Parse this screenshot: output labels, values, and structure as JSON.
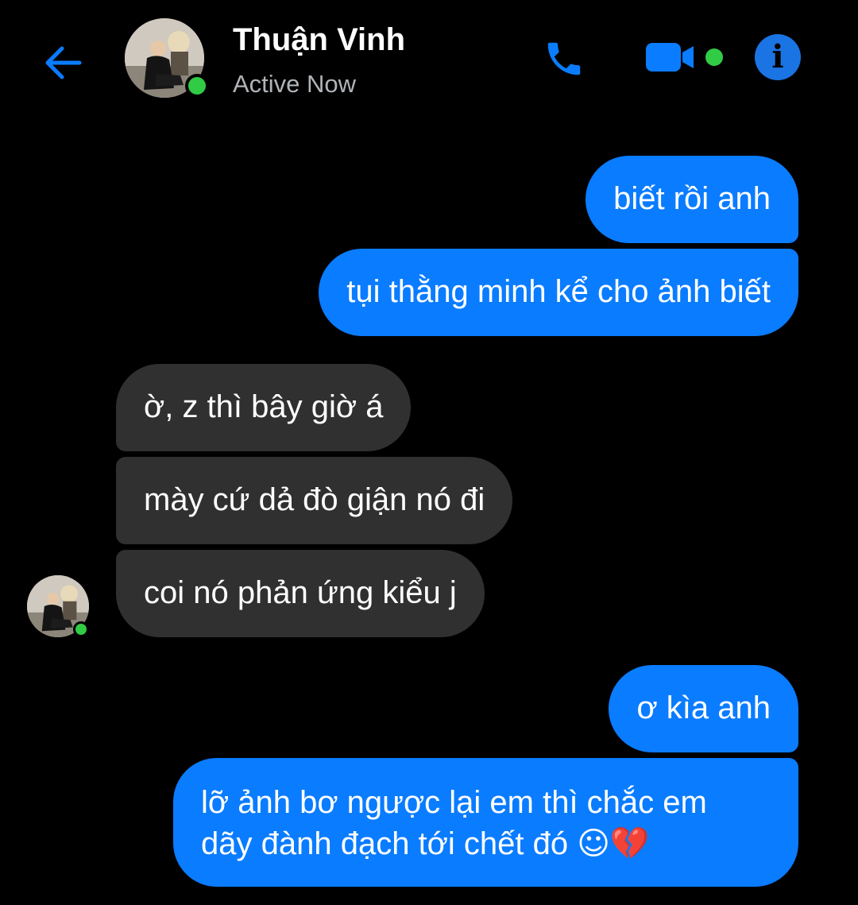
{
  "header": {
    "contact_name": "Thuận Vinh",
    "status": "Active Now",
    "back_icon": "arrow-left-icon",
    "call_icon": "phone-icon",
    "video_icon": "video-camera-icon",
    "info_icon": "info-icon"
  },
  "colors": {
    "accent": "#0a7cff",
    "received_bubble": "#303030",
    "presence": "#31cc46",
    "background": "#000000"
  },
  "messages": [
    {
      "from": "me",
      "text": "biết rồi anh"
    },
    {
      "from": "me",
      "text": "tụi thằng minh kể cho ảnh biết"
    },
    {
      "from": "contact",
      "text": "ờ, z thì bây giờ á"
    },
    {
      "from": "contact",
      "text": "mày cứ dả đò giận nó đi"
    },
    {
      "from": "contact",
      "text": "coi nó phản ứng kiểu j"
    },
    {
      "from": "me",
      "text": "ơ kìa anh"
    },
    {
      "from": "me",
      "text": "lỡ ảnh bơ ngược lại em thì chắc em dãy đành đạch tới chết đó",
      "emoji": "☺💔"
    }
  ]
}
